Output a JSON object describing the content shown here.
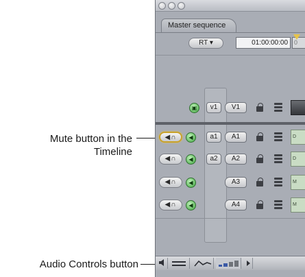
{
  "callouts": {
    "mute_line1": "Mute button in the",
    "mute_line2": "Timeline",
    "audio_controls": "Audio Controls button"
  },
  "window": {
    "tab_label": "Master sequence",
    "rt_button": "RT ▾",
    "timecode": "01:00:00:00",
    "timecode_overflow": "0"
  },
  "video_track": {
    "source": "v1",
    "dest": "V1"
  },
  "audio_tracks": [
    {
      "source": "a1",
      "dest": "A1",
      "mute_glyph": "◀∩",
      "clip": "D"
    },
    {
      "source": "a2",
      "dest": "A2",
      "mute_glyph": "◀∩",
      "clip": "D"
    },
    {
      "source": "",
      "dest": "A3",
      "mute_glyph": "◀∩",
      "clip": "M"
    },
    {
      "source": "",
      "dest": "A4",
      "mute_glyph": "◀∩",
      "clip": "M"
    }
  ],
  "icons": {
    "speaker": "speaker-icon",
    "lock": "lock-icon",
    "auto_select": "auto-select-icon",
    "record": "record-icon"
  },
  "colors": {
    "accent_highlight": "#c9a22a",
    "green_control": "#3ea43e",
    "window_bg": "#a9adb5"
  }
}
